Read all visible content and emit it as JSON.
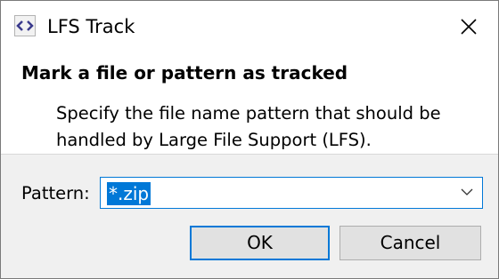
{
  "window": {
    "title": "LFS Track",
    "icon": "code-brackets-icon",
    "close_icon": "close-icon"
  },
  "content": {
    "heading": "Mark a file or pattern as tracked",
    "description": "Specify the file name pattern that should be handled by Large File Support (LFS)."
  },
  "form": {
    "pattern_label": "Pattern:",
    "pattern_value": "*.zip",
    "dropdown_icon": "chevron-down-icon"
  },
  "buttons": {
    "ok": "OK",
    "cancel": "Cancel"
  },
  "colors": {
    "accent": "#0078d7",
    "panel_bg": "#f0f0f0",
    "button_bg": "#e1e1e1"
  }
}
